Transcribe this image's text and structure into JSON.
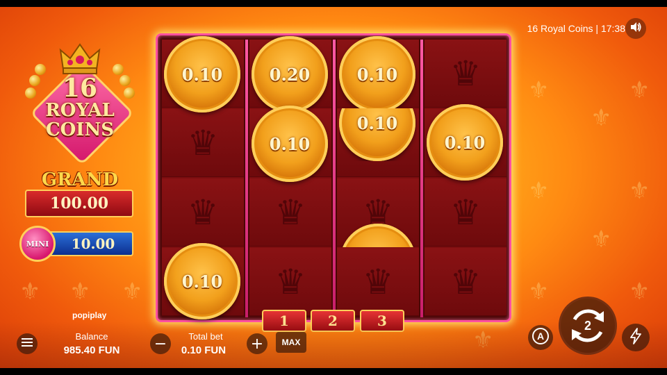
{
  "header": {
    "game_title": "16 Royal Coins",
    "separator": "|",
    "time": "17:38"
  },
  "logo": {
    "line1": "16",
    "line2": "ROYAL",
    "line3": "COINS"
  },
  "jackpots": {
    "grand_label": "GRAND",
    "grand_value": "100.00",
    "mini_label": "MINI",
    "mini_value": "10.00"
  },
  "reels": {
    "coins": [
      "0.10",
      "0.20",
      "0.10",
      "0.10",
      "0.10",
      "0.10",
      "0.10"
    ]
  },
  "lines": [
    "1",
    "2",
    "3"
  ],
  "brand": "popiplay",
  "footer": {
    "balance_label": "Balance",
    "balance_value": "985.40 FUN",
    "bet_label": "Total bet",
    "bet_value": "0.10 FUN",
    "minus": "−",
    "plus": "+",
    "max_label": "MAX",
    "spin_count": "2"
  },
  "icons": [
    "sound-icon",
    "menu-icon",
    "minus-icon",
    "plus-icon",
    "autoplay-icon",
    "spin-icon",
    "turbo-icon"
  ],
  "colors": {
    "frame": "#ff4fa0",
    "coin": "#f2a01c",
    "grand": "#c81a22",
    "mini": "#1d4fc0"
  }
}
